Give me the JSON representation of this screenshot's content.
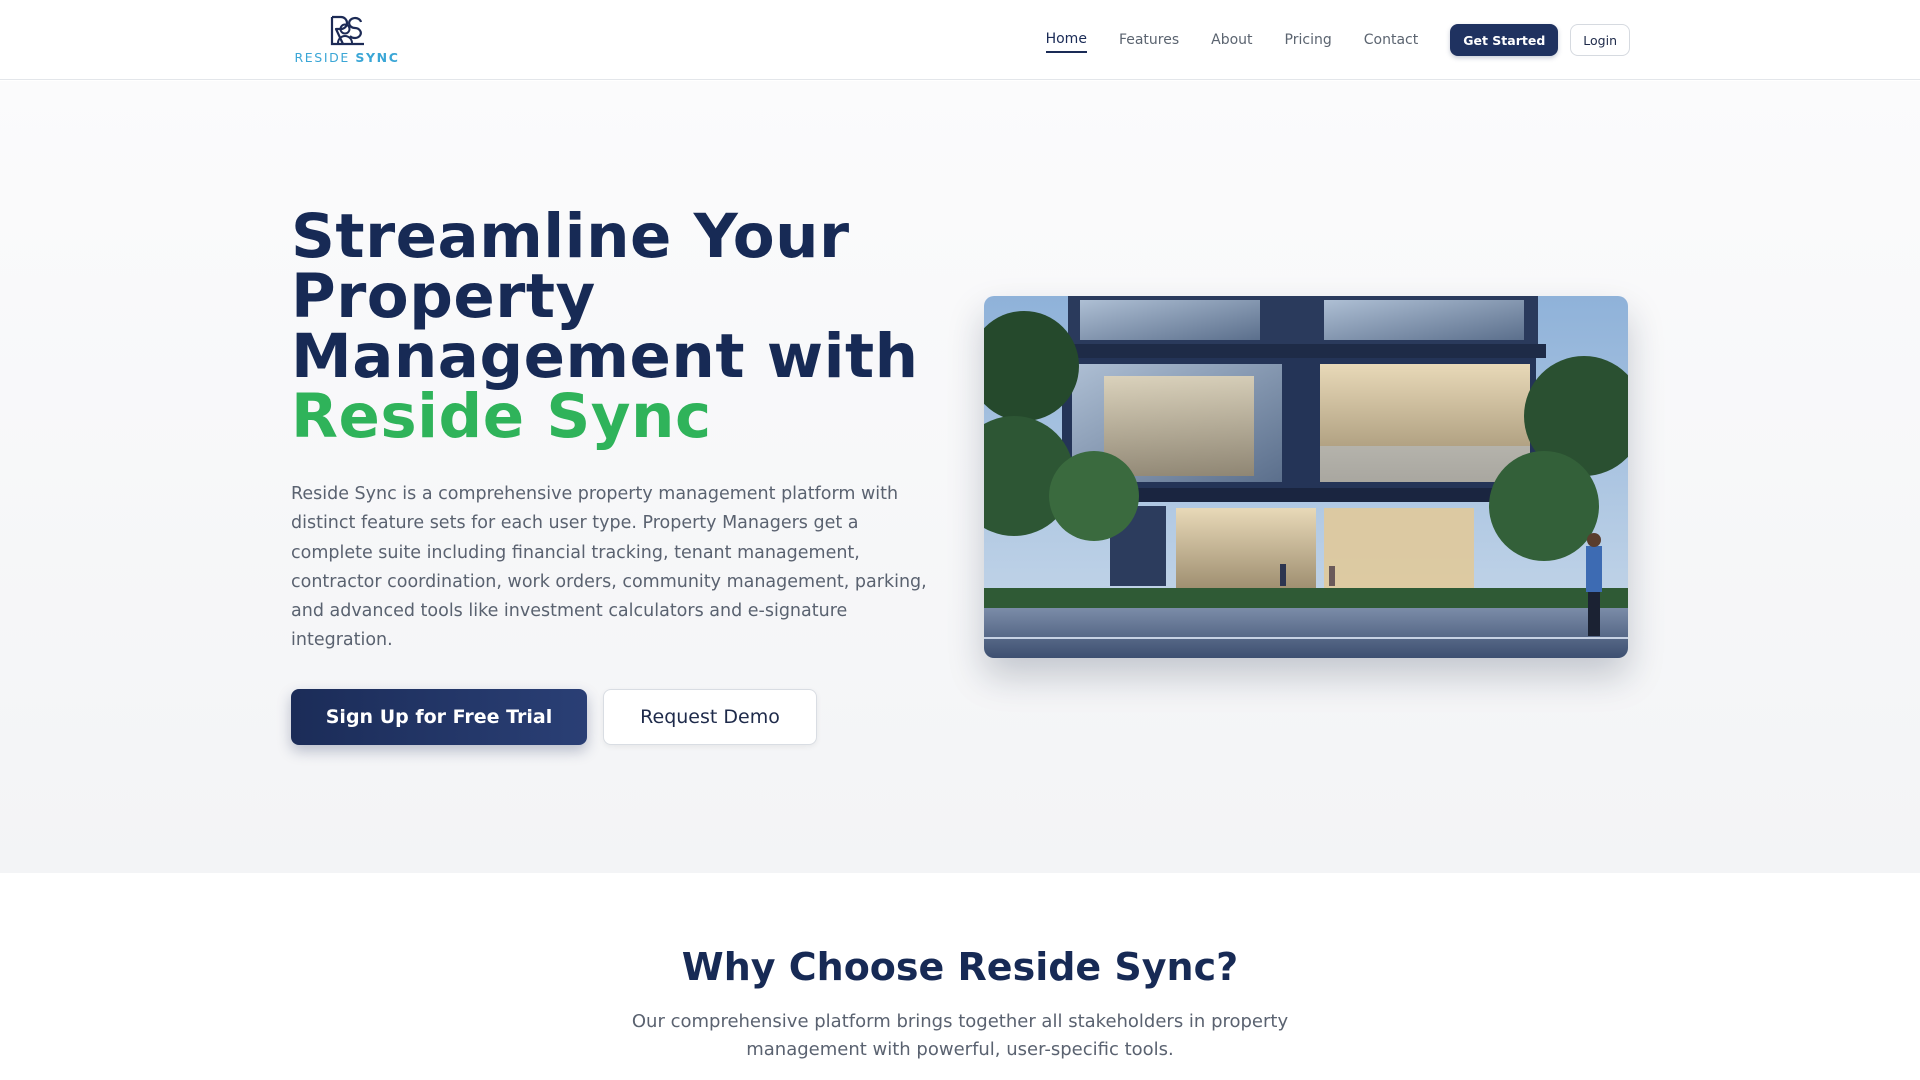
{
  "brand": {
    "name_light": "RESIDE",
    "name_bold": "SYNC",
    "colors": {
      "primary": "#172a55",
      "accent": "#2fb35a",
      "logo": "#3aa6d6"
    }
  },
  "nav": {
    "links": [
      "Home",
      "Features",
      "About",
      "Pricing",
      "Contact"
    ],
    "active": "Home",
    "get_started": "Get Started",
    "login": "Login"
  },
  "hero": {
    "title_lines": [
      "Streamline Your",
      "Property",
      "Management with"
    ],
    "title_accent": "Reside Sync",
    "description": "Reside Sync is a comprehensive property management platform with distinct feature sets for each user type. Property Managers get a complete suite including financial tracking, tenant management, contractor coordination, work orders, community management, parking, and advanced tools like investment calculators and e-signature integration.",
    "primary_cta": "Sign Up for Free Trial",
    "secondary_cta": "Request Demo",
    "image_icon": "modern-building-photo"
  },
  "why": {
    "title": "Why Choose Reside Sync?",
    "subtitle": "Our comprehensive platform brings together all stakeholders in property management with powerful, user-specific tools."
  }
}
